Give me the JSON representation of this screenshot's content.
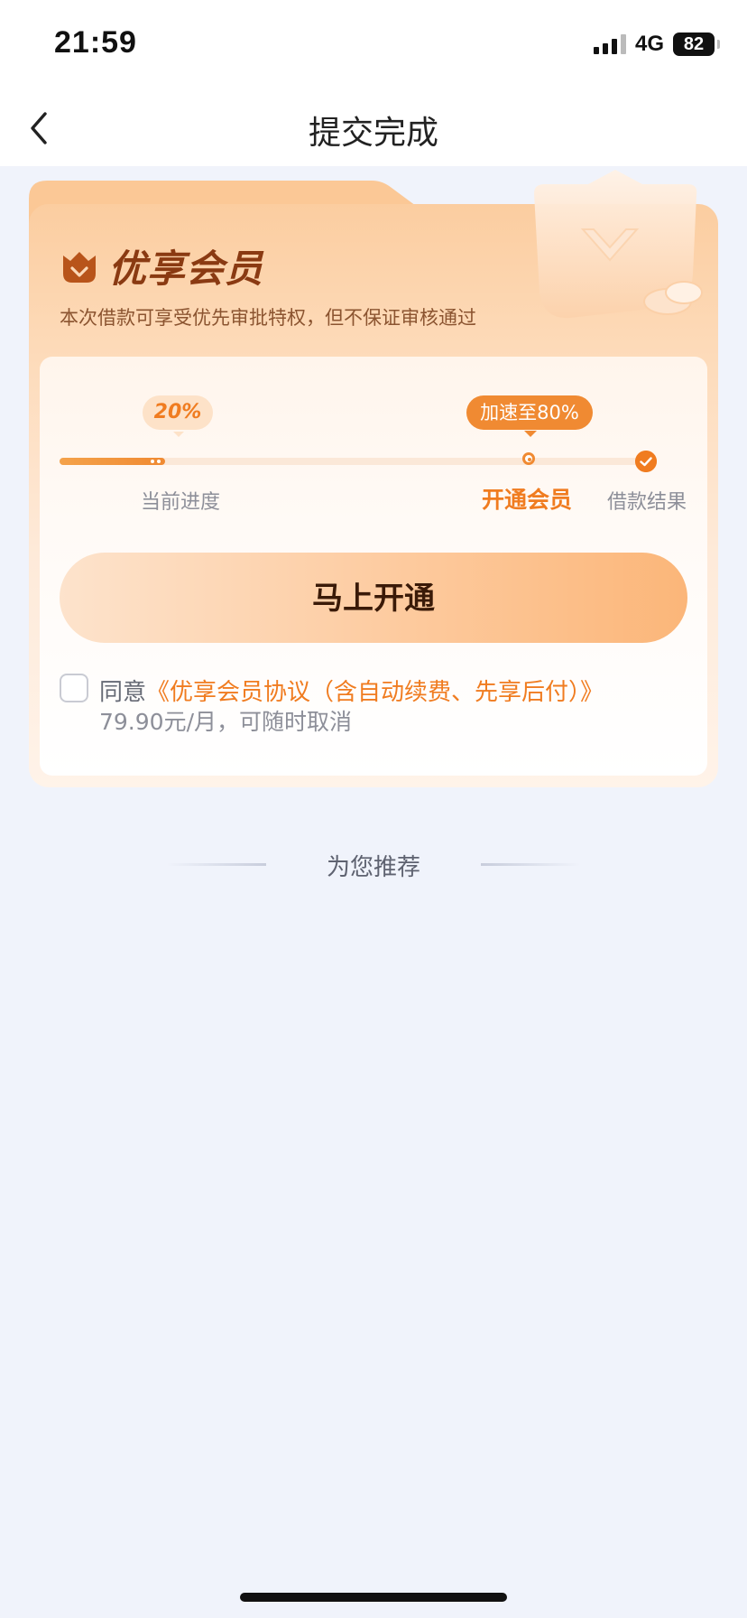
{
  "status_bar": {
    "time": "21:59",
    "network": "4G",
    "battery": "82"
  },
  "header": {
    "title": "提交完成",
    "back_icon": "chevron-left-icon"
  },
  "membership": {
    "title": "优享会员",
    "subtitle": "本次借款可享受优先审批特权，但不保证审核通过",
    "progress": {
      "current_percent_label": "20%",
      "current_fraction": 0.18,
      "boost_label": "加速至80%",
      "steps": [
        "当前进度",
        "开通会员",
        "借款结果"
      ]
    },
    "cta_label": "马上开通",
    "agreement": {
      "prefix": "同意",
      "link": "《优享会员协议（含自动续费、先享后付）》",
      "price_note": "79.90元/月，可随时取消",
      "checked": false
    }
  },
  "recommend": {
    "title": "为您推荐"
  },
  "colors": {
    "accent": "#f07c20",
    "brand_dark": "#8a3a12",
    "page_bg": "#f0f3fb"
  }
}
